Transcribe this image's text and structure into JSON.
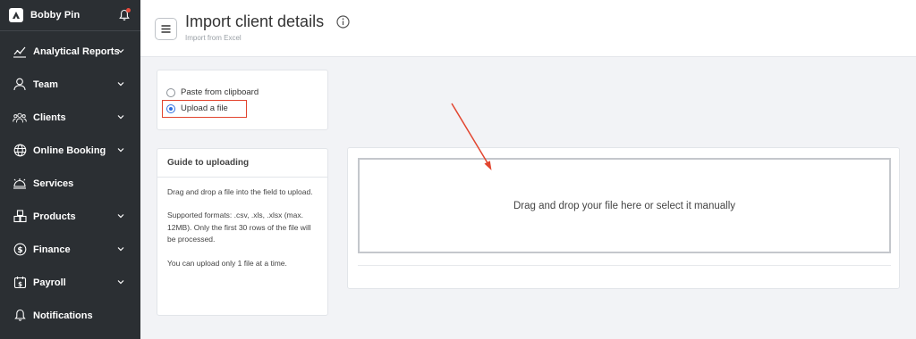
{
  "sidebar": {
    "user_name": "Bobby Pin",
    "items": [
      {
        "label": "Analytical Reports",
        "icon": "chart-line-icon",
        "has_chevron": true
      },
      {
        "label": "Team",
        "icon": "user-icon",
        "has_chevron": true
      },
      {
        "label": "Clients",
        "icon": "users-group-icon",
        "has_chevron": true
      },
      {
        "label": "Online Booking",
        "icon": "globe-icon",
        "has_chevron": true
      },
      {
        "label": "Services",
        "icon": "services-icon",
        "has_chevron": false
      },
      {
        "label": "Products",
        "icon": "boxes-icon",
        "has_chevron": true
      },
      {
        "label": "Finance",
        "icon": "dollar-icon",
        "has_chevron": true
      },
      {
        "label": "Payroll",
        "icon": "payroll-icon",
        "has_chevron": true
      },
      {
        "label": "Notifications",
        "icon": "bell-icon",
        "has_chevron": false
      }
    ]
  },
  "header": {
    "title": "Import client details",
    "subtitle": "Import from Excel"
  },
  "source": {
    "options": [
      {
        "label": "Paste from clipboard",
        "selected": false
      },
      {
        "label": "Upload a file",
        "selected": true
      }
    ]
  },
  "guide": {
    "title": "Guide to uploading",
    "paragraphs": [
      "Drag and drop a file into the field to upload.",
      "Supported formats: .csv, .xls, .xlsx (max. 12MB). Only the first 30 rows of the file will be processed.",
      "You can upload only 1 file at a time."
    ]
  },
  "upload": {
    "dropzone_text": "Drag and drop your file here or select it manually"
  },
  "colors": {
    "sidebar_bg": "#2b2f33",
    "annotation_red": "#e2452f",
    "radio_blue": "#2f6fe0",
    "page_bg": "#f2f3f6"
  }
}
